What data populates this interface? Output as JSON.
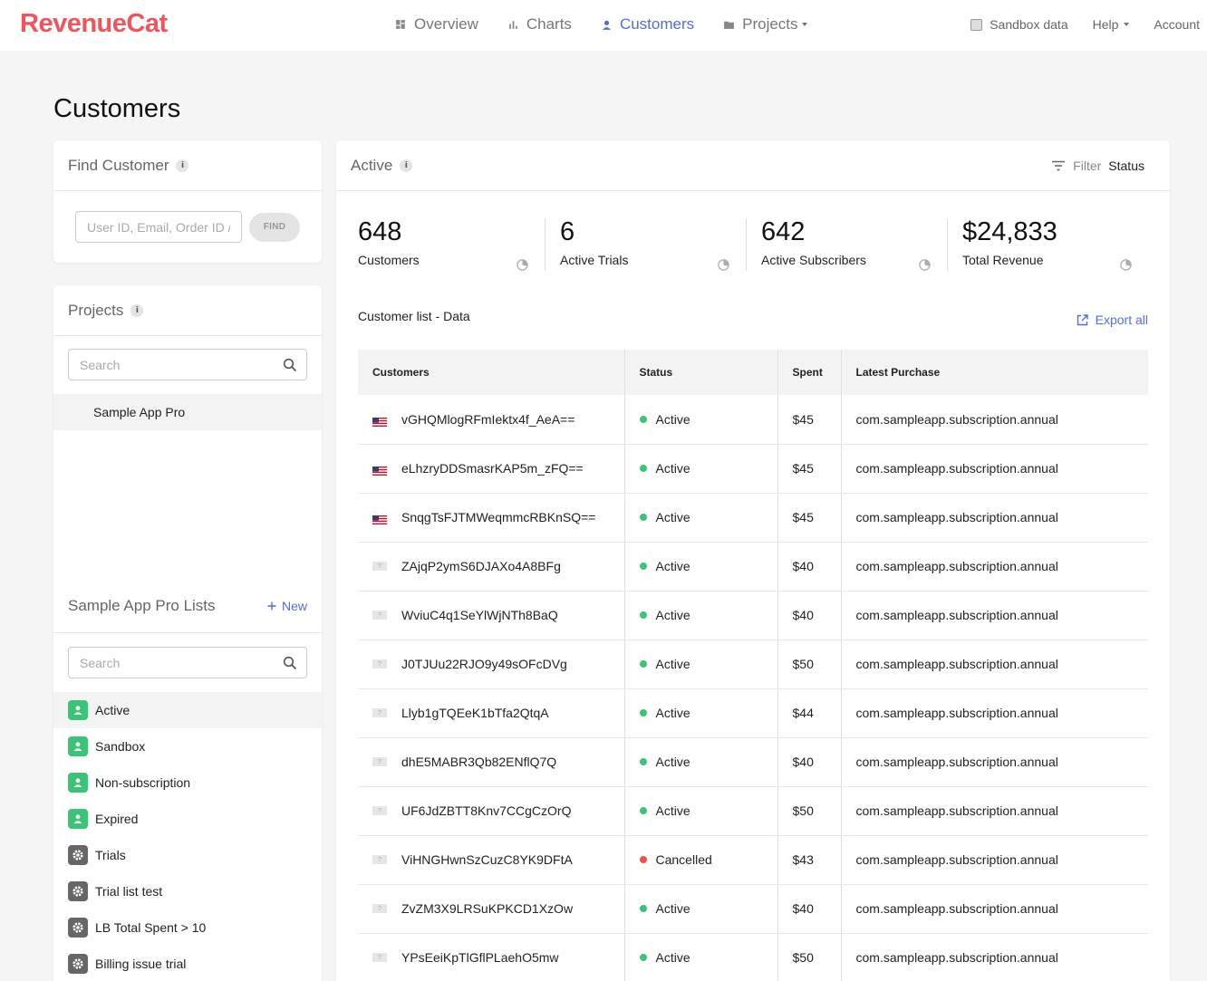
{
  "brand": {
    "name": "RevenueCat",
    "color": "#f2545b"
  },
  "nav": {
    "items": [
      {
        "label": "Overview",
        "icon": "overview-icon"
      },
      {
        "label": "Charts",
        "icon": "charts-icon"
      },
      {
        "label": "Customers",
        "icon": "person-icon",
        "active": true
      },
      {
        "label": "Projects",
        "icon": "folder-icon"
      }
    ],
    "right": {
      "sandbox": "Sandbox data",
      "help": "Help",
      "account": "Account"
    }
  },
  "page": {
    "title": "Customers"
  },
  "find_customer": {
    "title": "Find Customer",
    "info": "i",
    "placeholder": "User ID, Email, Order ID / Token",
    "button": "FIND"
  },
  "projects": {
    "title": "Projects",
    "info": "i",
    "search_placeholder": "Search",
    "items": [
      "Sample App Pro"
    ]
  },
  "lists": {
    "title": "Sample App Pro Lists",
    "new_label": "New",
    "search_placeholder": "Search",
    "items": [
      {
        "label": "Active",
        "icon": "person-icon",
        "selected": true
      },
      {
        "label": "Sandbox",
        "icon": "person-icon"
      },
      {
        "label": "Non-subscription",
        "icon": "person-icon"
      },
      {
        "label": "Expired",
        "icon": "person-icon"
      },
      {
        "label": "Trials",
        "icon": "gear-icon"
      },
      {
        "label": "Trial list test",
        "icon": "gear-icon"
      },
      {
        "label": "LB Total Spent > 10",
        "icon": "gear-icon"
      },
      {
        "label": "Billing issue trial",
        "icon": "gear-icon"
      }
    ]
  },
  "main": {
    "title": "Active",
    "info": "i",
    "filter_label": "Filter",
    "filter_value": "Status",
    "stats": [
      {
        "value": "648",
        "label": "Customers"
      },
      {
        "value": "6",
        "label": "Active Trials"
      },
      {
        "value": "642",
        "label": "Active Subscribers"
      },
      {
        "value": "$24,833",
        "label": "Total Revenue"
      }
    ],
    "list_title": "Customer list - Data",
    "export_label": "Export all",
    "columns": [
      "Customers",
      "Status",
      "Spent",
      "Latest Purchase"
    ],
    "rows": [
      {
        "flag": "us",
        "id": "vGHQMlogRFmIektx4f_AeA==",
        "status": "Active",
        "spent": "$45",
        "purchase": "com.sampleapp.subscription.annual"
      },
      {
        "flag": "us",
        "id": "eLhzryDDSmasrKAP5m_zFQ==",
        "status": "Active",
        "spent": "$45",
        "purchase": "com.sampleapp.subscription.annual"
      },
      {
        "flag": "us",
        "id": "SnqgTsFJTMWeqmmcRBKnSQ==",
        "status": "Active",
        "spent": "$45",
        "purchase": "com.sampleapp.subscription.annual"
      },
      {
        "flag": "unknown",
        "id": "ZAjqP2ymS6DJAXo4A8BFg",
        "status": "Active",
        "spent": "$40",
        "purchase": "com.sampleapp.subscription.annual"
      },
      {
        "flag": "unknown",
        "id": "WviuC4q1SeYlWjNTh8BaQ",
        "status": "Active",
        "spent": "$40",
        "purchase": "com.sampleapp.subscription.annual"
      },
      {
        "flag": "unknown",
        "id": "J0TJUu22RJO9y49sOFcDVg",
        "status": "Active",
        "spent": "$50",
        "purchase": "com.sampleapp.subscription.annual"
      },
      {
        "flag": "unknown",
        "id": "Llyb1gTQEeK1bTfa2QtqA",
        "status": "Active",
        "spent": "$44",
        "purchase": "com.sampleapp.subscription.annual"
      },
      {
        "flag": "unknown",
        "id": "dhE5MABR3Qb82ENflQ7Q",
        "status": "Active",
        "spent": "$40",
        "purchase": "com.sampleapp.subscription.annual"
      },
      {
        "flag": "unknown",
        "id": "UF6JdZBTT8Knv7CCgCzOrQ",
        "status": "Active",
        "spent": "$50",
        "purchase": "com.sampleapp.subscription.annual"
      },
      {
        "flag": "unknown",
        "id": "ViHNGHwnSzCuzC8YK9DFtA",
        "status": "Cancelled",
        "spent": "$43",
        "purchase": "com.sampleapp.subscription.annual"
      },
      {
        "flag": "unknown",
        "id": "ZvZM3X9LRSuKPKCD1XzOw",
        "status": "Active",
        "spent": "$40",
        "purchase": "com.sampleapp.subscription.annual"
      },
      {
        "flag": "unknown",
        "id": "YPsEeiKpTlGflPLaehO5mw",
        "status": "Active",
        "spent": "$50",
        "purchase": "com.sampleapp.subscription.annual"
      }
    ],
    "status_colors": {
      "Active": "#3bc477",
      "Cancelled": "#ef5350"
    }
  },
  "colors": {
    "accent": "#576cdb",
    "active_green": "#3bc477",
    "cancelled_red": "#ef5350"
  }
}
